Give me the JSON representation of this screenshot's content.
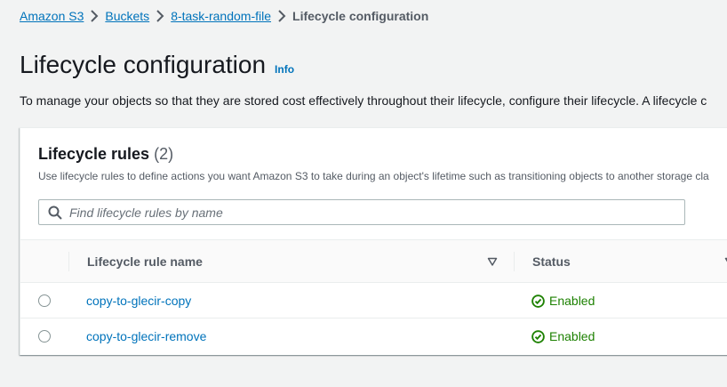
{
  "breadcrumb": {
    "items": [
      "Amazon S3",
      "Buckets",
      "8-task-random-file"
    ],
    "current": "Lifecycle configuration"
  },
  "page": {
    "title": "Lifecycle configuration",
    "info": "Info",
    "description": "To manage your objects so that they are stored cost effectively throughout their lifecycle, configure their lifecycle. A lifecycle c"
  },
  "rules": {
    "heading": "Lifecycle rules",
    "count": "(2)",
    "description": "Use lifecycle rules to define actions you want Amazon S3 to take during an object's lifetime such as transitioning objects to another storage cla",
    "search_placeholder": "Find lifecycle rules by name",
    "search_value": "",
    "columns": [
      "Lifecycle rule name",
      "Status"
    ],
    "rows": [
      {
        "name": "copy-to-glecir-copy",
        "status": "Enabled"
      },
      {
        "name": "copy-to-glecir-remove",
        "status": "Enabled"
      }
    ]
  },
  "colors": {
    "link": "#0073bb",
    "success": "#1d8102",
    "background": "#f2f3f3"
  },
  "icons": {
    "breadcrumb_separator": "chevron-right-icon",
    "search": "search-icon",
    "sort": "sort-caret-icon",
    "status": "check-circle-icon"
  }
}
